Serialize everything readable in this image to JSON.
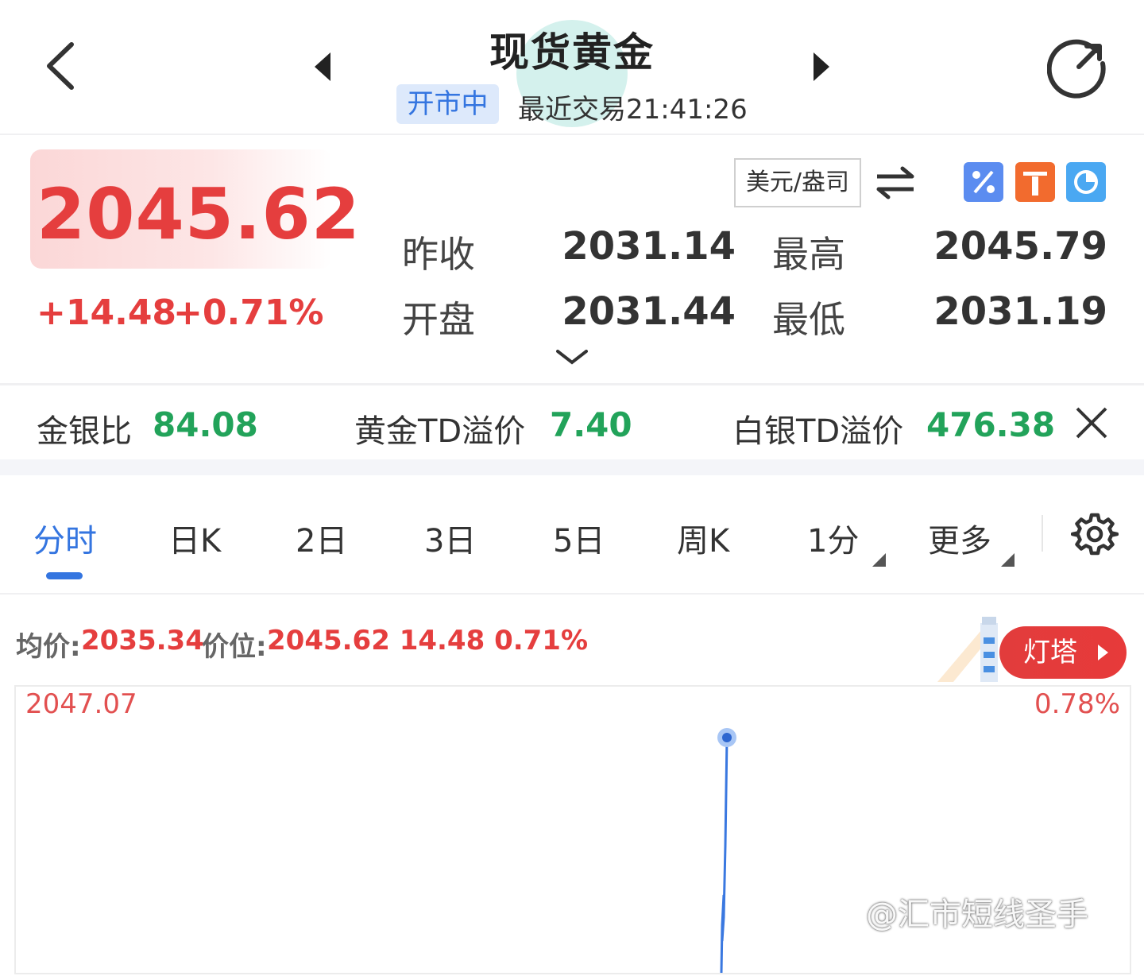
{
  "header": {
    "title": "现货黄金",
    "status": "开市中",
    "last_trade": "最近交易21:41:26"
  },
  "quote": {
    "price": "2045.62",
    "change": "+14.48",
    "change_pct": "+0.71%",
    "unit": "美元/盎司",
    "prev_close_label": "昨收",
    "prev_close": "2031.14",
    "high_label": "最高",
    "high": "2045.79",
    "open_label": "开盘",
    "open": "2031.44",
    "low_label": "最低",
    "low": "2031.19",
    "up_color": "#e53e3e"
  },
  "ratios": [
    {
      "label": "金银比",
      "value": "84.08"
    },
    {
      "label": "黄金TD溢价",
      "value": "7.40"
    },
    {
      "label": "白银TD溢价",
      "value": "476.38"
    }
  ],
  "tabs": [
    "分时",
    "日K",
    "2日",
    "3日",
    "5日",
    "周K",
    "1分",
    "更多"
  ],
  "active_tab": "分时",
  "info": {
    "avg_label": "均价:",
    "avg_value": "2035.34",
    "price_label": "价位:",
    "price_value": "2045.62 14.48 0.71%",
    "beacon": "灯塔"
  },
  "chart_data": {
    "type": "line",
    "ymax_label": "2047.07",
    "ymax_pct_label": "0.78%",
    "last_price": 2045.62
  },
  "watermark": "@汇市短线圣手",
  "accent_color": "#3475e0",
  "green_color": "#22a35a"
}
